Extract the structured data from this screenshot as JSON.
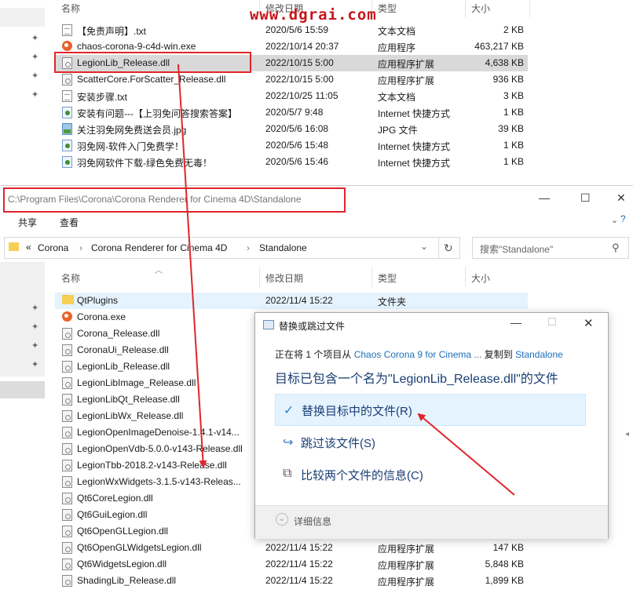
{
  "watermark": "www.dgrai.com",
  "top_list": {
    "columns": {
      "name": "名称",
      "date": "修改日期",
      "type": "类型",
      "size": "大小"
    },
    "rows": [
      {
        "icon": "text-file-icon",
        "name": "【免责声明】.txt",
        "date": "2020/5/6 15:59",
        "type": "文本文档",
        "size": "2 KB"
      },
      {
        "icon": "exe-icon",
        "name": "chaos-corona-9-c4d-win.exe",
        "date": "2022/10/14 20:37",
        "type": "应用程序",
        "size": "463,217 KB"
      },
      {
        "icon": "dll-icon",
        "name": "LegionLib_Release.dll",
        "date": "2022/10/15 5:00",
        "type": "应用程序扩展",
        "size": "4,638 KB"
      },
      {
        "icon": "dll-icon",
        "name": "ScatterCore.ForScatter_Release.dll",
        "date": "2022/10/15 5:00",
        "type": "应用程序扩展",
        "size": "936 KB"
      },
      {
        "icon": "text-file-icon",
        "name": "安装步骤.txt",
        "date": "2022/10/25 11:05",
        "type": "文本文档",
        "size": "3 KB"
      },
      {
        "icon": "url-icon",
        "name": "安装有问题---【上羽免问答搜索答案】",
        "date": "2020/5/7 9:48",
        "type": "Internet 快捷方式",
        "size": "1 KB"
      },
      {
        "icon": "jpg-icon",
        "name": "关注羽免网免费送会员.jpg",
        "date": "2020/5/6 16:08",
        "type": "JPG 文件",
        "size": "39 KB"
      },
      {
        "icon": "url-icon",
        "name": "羽免网-软件入门免费学！",
        "date": "2020/5/6 15:48",
        "type": "Internet 快捷方式",
        "size": "1 KB"
      },
      {
        "icon": "url-icon",
        "name": "羽免网软件下载-绿色免费无毒！",
        "date": "2020/5/6 15:46",
        "type": "Internet 快捷方式",
        "size": "1 KB"
      }
    ]
  },
  "window2": {
    "title_path": "C:\\Program Files\\Corona\\Corona Renderer for Cinema 4D\\Standalone",
    "controls": {
      "minimize": "—",
      "maximize": "☐",
      "close": "✕"
    },
    "ribbon_tabs": [
      "共享",
      "查看"
    ],
    "breadcrumb": {
      "prefix": "«",
      "items": [
        "Corona",
        "Corona Renderer for Cinema 4D",
        "Standalone"
      ]
    },
    "search_placeholder": "搜索\"Standalone\"",
    "columns": {
      "name": "名称",
      "date": "修改日期",
      "type": "类型",
      "size": "大小"
    },
    "rows": [
      {
        "icon": "folder-icon",
        "name": "QtPlugins",
        "date": "2022/11/4 15:22",
        "type": "文件夹",
        "size": ""
      },
      {
        "icon": "exe-icon",
        "name": "Corona.exe",
        "date": "",
        "type": "",
        "size": ""
      },
      {
        "icon": "dll-icon",
        "name": "Corona_Release.dll",
        "date": "",
        "type": "",
        "size": ""
      },
      {
        "icon": "dll-icon",
        "name": "CoronaUi_Release.dll",
        "date": "",
        "type": "",
        "size": ""
      },
      {
        "icon": "dll-icon",
        "name": "LegionLib_Release.dll",
        "date": "",
        "type": "",
        "size": ""
      },
      {
        "icon": "dll-icon",
        "name": "LegionLibImage_Release.dll",
        "date": "",
        "type": "",
        "size": ""
      },
      {
        "icon": "dll-icon",
        "name": "LegionLibQt_Release.dll",
        "date": "",
        "type": "",
        "size": ""
      },
      {
        "icon": "dll-icon",
        "name": "LegionLibWx_Release.dll",
        "date": "",
        "type": "",
        "size": ""
      },
      {
        "icon": "dll-icon",
        "name": "LegionOpenImageDenoise-1.4.1-v14...",
        "date": "",
        "type": "",
        "size": ""
      },
      {
        "icon": "dll-icon",
        "name": "LegionOpenVdb-5.0.0-v143-Release.dll",
        "date": "",
        "type": "",
        "size": ""
      },
      {
        "icon": "dll-icon",
        "name": "LegionTbb-2018.2-v143-Release.dll",
        "date": "",
        "type": "",
        "size": ""
      },
      {
        "icon": "dll-icon",
        "name": "LegionWxWidgets-3.1.5-v143-Releas...",
        "date": "",
        "type": "",
        "size": ""
      },
      {
        "icon": "dll-icon",
        "name": "Qt6CoreLegion.dll",
        "date": "",
        "type": "",
        "size": ""
      },
      {
        "icon": "dll-icon",
        "name": "Qt6GuiLegion.dll",
        "date": "",
        "type": "",
        "size": ""
      },
      {
        "icon": "dll-icon",
        "name": "Qt6OpenGLLegion.dll",
        "date": "",
        "type": "",
        "size": ""
      },
      {
        "icon": "dll-icon",
        "name": "Qt6OpenGLWidgetsLegion.dll",
        "date": "2022/11/4 15:22",
        "type": "应用程序扩展",
        "size": "147 KB"
      },
      {
        "icon": "dll-icon",
        "name": "Qt6WidgetsLegion.dll",
        "date": "2022/11/4 15:22",
        "type": "应用程序扩展",
        "size": "5,848 KB"
      },
      {
        "icon": "dll-icon",
        "name": "ShadingLib_Release.dll",
        "date": "2022/11/4 15:22",
        "type": "应用程序扩展",
        "size": "1,899 KB"
      }
    ]
  },
  "dialog": {
    "title": "替换或跳过文件",
    "copy_line": {
      "prefix": "正在将 1 个项目从 ",
      "source": "Chaos Corona 9 for Cinema ...",
      "middle": " 复制到 ",
      "dest": "Standalone"
    },
    "heading": "目标已包含一个名为\"LegionLib_Release.dll\"的文件",
    "options": [
      {
        "glyph": "✓",
        "label": "替换目标中的文件(R)"
      },
      {
        "glyph": "↪",
        "label": "跳过该文件(S)"
      },
      {
        "glyph": "⧉",
        "label": "比较两个文件的信息(C)"
      }
    ],
    "details": "详细信息"
  },
  "colors": {
    "annotation_red": "#e0262b",
    "watermark_red": "#c4161c",
    "link_blue": "#1e6fb8",
    "selection": "#e5f3ff"
  }
}
